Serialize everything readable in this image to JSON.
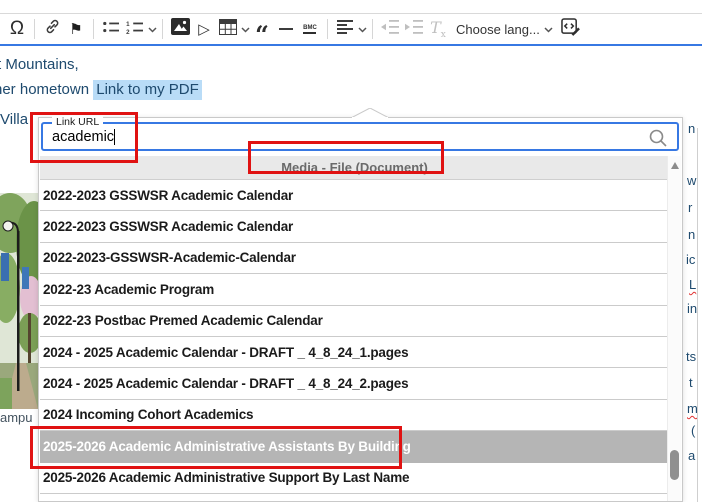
{
  "toolbar": {
    "choose_language_label": "Choose lang...",
    "bmc_label": "BMC",
    "remove_format_t": "T",
    "remove_format_x": "x",
    "special_char_label": "Ω",
    "flag_glyph": "⚑",
    "media_glyph": "▷",
    "quote_glyph": "“",
    "icon_names": [
      "special-character",
      "link",
      "flag-bookmark",
      "bulleted-list",
      "numbered-list",
      "image",
      "media-embed",
      "table",
      "block-quote",
      "horizontal-line",
      "bmc-break",
      "alignment",
      "outdent",
      "indent",
      "remove-format",
      "language-dropdown",
      "source-editing"
    ]
  },
  "document": {
    "line1": "t Mountains,",
    "line2_prefix": "her hometown ",
    "link_text": "Link to my PDF",
    "line3": "Villa",
    "image_caption": "ampu",
    "right_fragments": [
      {
        "text": "n"
      },
      {
        "text": "w"
      },
      {
        "text": "r"
      },
      {
        "text": "n"
      },
      {
        "text": "ic"
      },
      {
        "text": "L"
      },
      {
        "text": "in"
      },
      {
        "text": "ts"
      },
      {
        "text": "t"
      },
      {
        "text": "m"
      },
      {
        "text": "("
      },
      {
        "text": "a"
      }
    ]
  },
  "link_dialog": {
    "field_label": "Link URL",
    "field_value": "academic",
    "group_header": "Media - File (Document)",
    "selected_index": 8,
    "items": [
      "2022-2023 GSSWSR Academic Calendar",
      "2022-2023 GSSWSR Academic Calendar",
      "2022-2023-GSSWSR-Academic-Calendar",
      "2022-23 Academic Program",
      "2022-23 Postbac Premed Academic Calendar",
      "2024 - 2025 Academic Calendar - DRAFT _ 4_8_24_1.pages",
      "2024 - 2025 Academic Calendar - DRAFT _ 4_8_24_2.pages",
      "2024 Incoming Cohort Academics",
      "2025-2026 Academic Administrative Assistants By Building",
      "2025-2026 Academic Administrative Support By Last Name"
    ]
  },
  "colors": {
    "accent_blue": "#3778e3",
    "selection_highlight": "#b9dcf7",
    "annotation_red": "#e01212",
    "selected_row_gray": "#b5b5b5",
    "group_header_bg": "#e9e9e9",
    "body_text_navy": "#1e4a6e"
  }
}
